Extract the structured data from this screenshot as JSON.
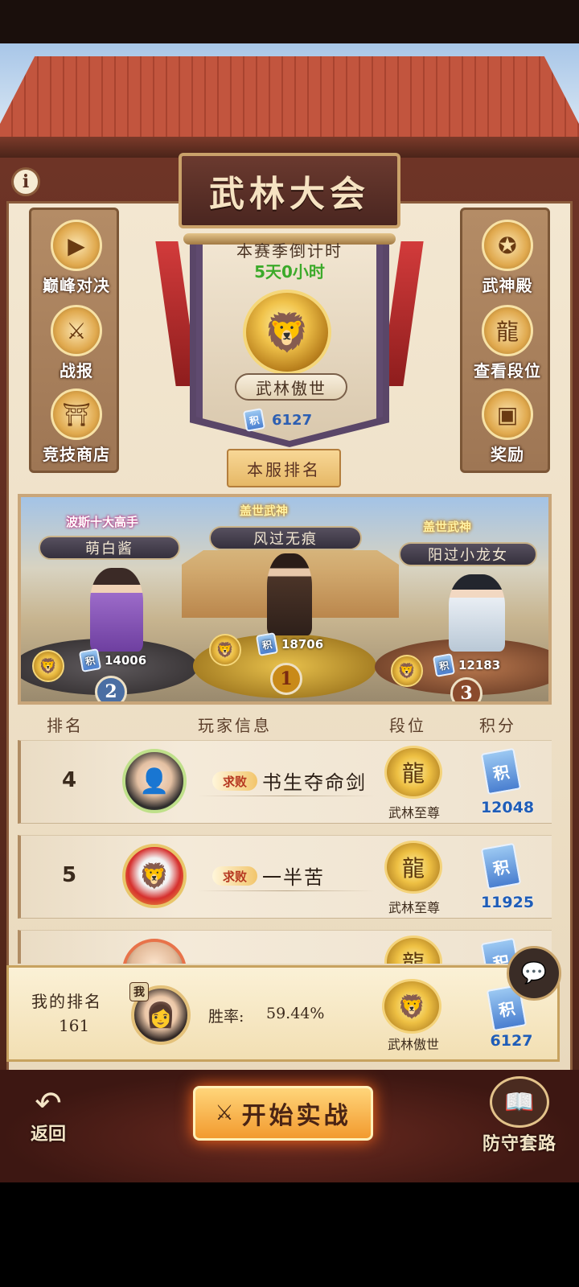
{
  "title": "武林大会",
  "season": {
    "countdown_label": "本赛季倒计时",
    "countdown_value": "5天0小时",
    "tier_name": "武林傲世",
    "score": "6127"
  },
  "server_rank_label": "本服排名",
  "left_menu": [
    {
      "label": "巅峰对决",
      "icon": "play-icon"
    },
    {
      "label": "战报",
      "icon": "crossed-swords-scroll-icon"
    },
    {
      "label": "竞技商店",
      "icon": "shop-icon"
    }
  ],
  "right_menu": [
    {
      "label": "武神殿",
      "icon": "hall-badge-icon"
    },
    {
      "label": "查看段位",
      "icon": "dragon-icon"
    },
    {
      "label": "奖励",
      "icon": "chest-icon"
    }
  ],
  "podium": [
    {
      "place": "2",
      "title_tag": "波斯十大高手",
      "name": "萌白酱",
      "score": "14006"
    },
    {
      "place": "1",
      "title_tag": "盖世武神",
      "name": "风过无痕",
      "score": "18706"
    },
    {
      "place": "3",
      "title_tag": "盖世武神",
      "name": "阳过小龙女",
      "score": "12183"
    }
  ],
  "table": {
    "headers": {
      "rank": "排名",
      "player": "玩家信息",
      "tier": "段位",
      "points": "积分"
    },
    "rows": [
      {
        "rank": "4",
        "tag": "求败",
        "name": "书生夺命剑",
        "tier": "武林至尊",
        "points": "12048"
      },
      {
        "rank": "5",
        "tag": "求败",
        "name": "一半苦",
        "tier": "武林至尊",
        "points": "11925"
      },
      {
        "rank": "",
        "tag": "",
        "name": "",
        "tier": "",
        "points": ""
      }
    ]
  },
  "my_rank": {
    "label": "我的排名",
    "value": "161",
    "me_tag": "我",
    "winrate_label": "胜率:",
    "winrate_value": "59.44%",
    "tier": "武林傲世",
    "points": "6127"
  },
  "ji_glyph": "积",
  "info_glyph": "i",
  "bottom": {
    "back_label": "返回",
    "start_label": "开始实战",
    "defense_label": "防守套路"
  },
  "colors": {
    "countdown_green": "#3caa2a",
    "points_blue": "#1f5db8",
    "tag_red": "#b5361f"
  }
}
